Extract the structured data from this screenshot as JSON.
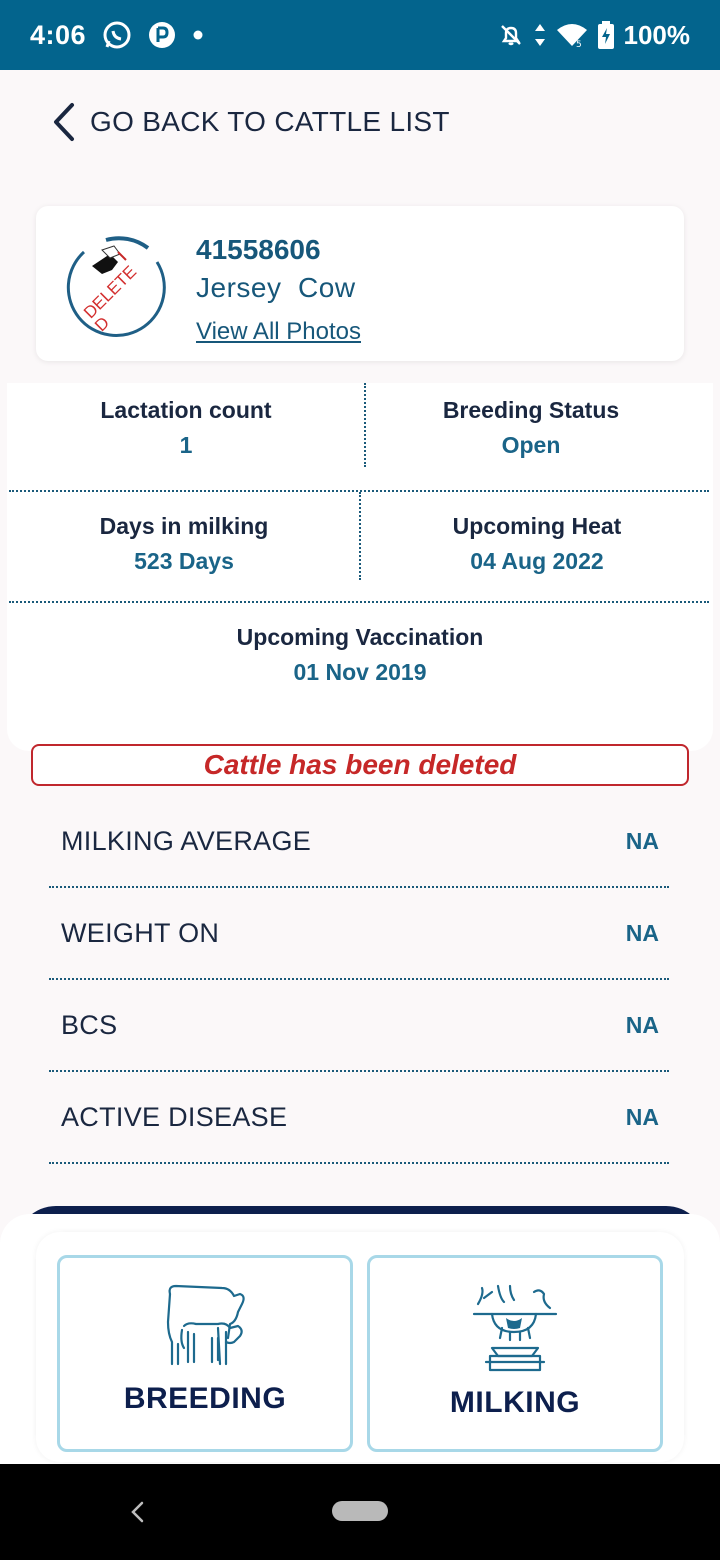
{
  "status_bar": {
    "time": "4:06",
    "battery": "100%",
    "icons": [
      "whatsapp-icon",
      "app-p-icon",
      "dot-icon",
      "bell-off-icon",
      "data-arrows-icon",
      "wifi-icon",
      "battery-charging-icon"
    ]
  },
  "header": {
    "back_label": "GO BACK TO CATTLE LIST"
  },
  "cattle": {
    "id": "41558606",
    "breed": "Jersey  Cow",
    "view_photos": "View All Photos",
    "stamp_text": "DELETE D"
  },
  "stats": {
    "lactation": {
      "label": "Lactation count",
      "value": "1"
    },
    "breeding": {
      "label": "Breeding Status",
      "value": "Open"
    },
    "milking_days": {
      "label": "Days in milking",
      "value": "523 Days"
    },
    "heat": {
      "label": "Upcoming Heat",
      "value": "04 Aug 2022"
    },
    "vaccination": {
      "label": "Upcoming Vaccination",
      "value": "01 Nov 2019"
    }
  },
  "deleted_banner": "Cattle has been deleted",
  "metrics": [
    {
      "label": "MILKING AVERAGE",
      "value": "NA"
    },
    {
      "label": "WEIGHT ON",
      "value": "NA"
    },
    {
      "label": "BCS",
      "value": "NA"
    },
    {
      "label": "ACTIVE DISEASE",
      "value": "NA"
    }
  ],
  "actions": {
    "breeding": "BREEDING",
    "milking": "MILKING"
  },
  "colors": {
    "status_bar": "#03648d",
    "accent": "#1a6488",
    "danger": "#c62828",
    "navy": "#0d1f4d",
    "tile_border": "#a8d8e8"
  }
}
